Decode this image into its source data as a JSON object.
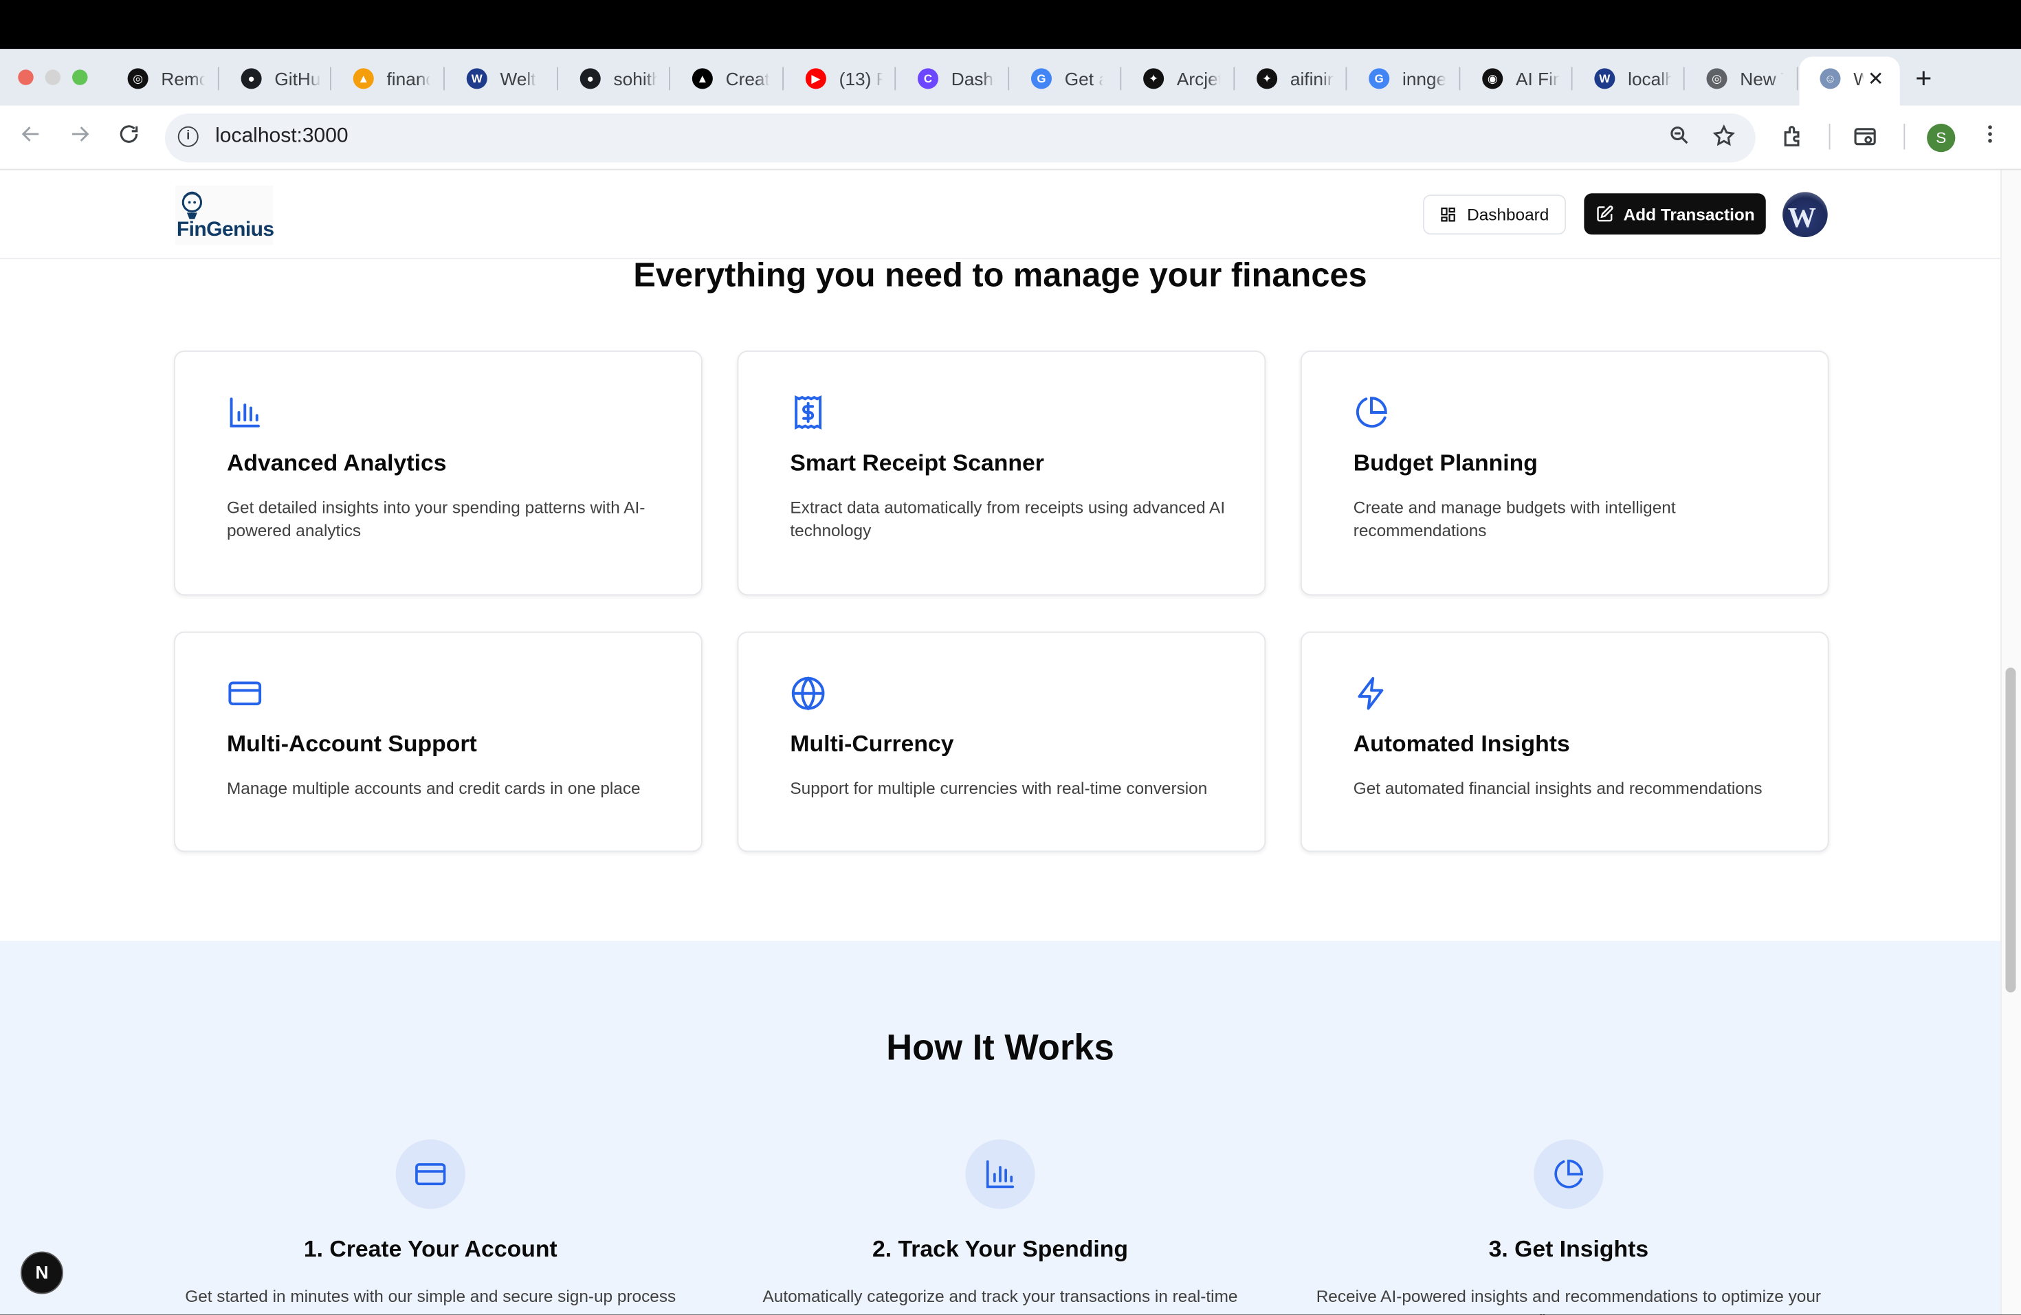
{
  "browser": {
    "tabs": [
      {
        "title": "Remo",
        "icon": "openai-icon"
      },
      {
        "title": "GitHu",
        "icon": "github-icon"
      },
      {
        "title": "financ",
        "icon": "finance-app-icon"
      },
      {
        "title": "Welth",
        "icon": "welth-icon"
      },
      {
        "title": "sohith",
        "icon": "github-icon"
      },
      {
        "title": "Create",
        "icon": "vercel-icon"
      },
      {
        "title": "(13) F",
        "icon": "youtube-icon"
      },
      {
        "title": "Dashb",
        "icon": "clerk-icon"
      },
      {
        "title": "Get a",
        "icon": "google-icon"
      },
      {
        "title": "Arcjet",
        "icon": "arcjet-icon"
      },
      {
        "title": "aifinin",
        "icon": "gemini-icon"
      },
      {
        "title": "innge",
        "icon": "google-icon"
      },
      {
        "title": "AI Fina",
        "icon": "ai-finance-icon"
      },
      {
        "title": "localh",
        "icon": "welth-icon"
      },
      {
        "title": "New T",
        "icon": "chrome-icon"
      },
      {
        "title": "W",
        "icon": "fingenius-icon"
      }
    ],
    "url": "localhost:3000",
    "profile_initial": "S"
  },
  "header": {
    "logo_text": "FinGenius",
    "dashboard_label": "Dashboard",
    "add_transaction_label": "Add Transaction",
    "avatar_letter": "W"
  },
  "features": {
    "title": "Everything you need to manage your finances",
    "cards": [
      {
        "icon": "bar-chart-icon",
        "title": "Advanced Analytics",
        "description": "Get detailed insights into your spending patterns with AI-powered analytics"
      },
      {
        "icon": "receipt-icon",
        "title": "Smart Receipt Scanner",
        "description": "Extract data automatically from receipts using advanced AI technology"
      },
      {
        "icon": "pie-chart-icon",
        "title": "Budget Planning",
        "description": "Create and manage budgets with intelligent recommendations"
      },
      {
        "icon": "credit-card-icon",
        "title": "Multi-Account Support",
        "description": "Manage multiple accounts and credit cards in one place"
      },
      {
        "icon": "globe-icon",
        "title": "Multi-Currency",
        "description": "Support for multiple currencies with real-time conversion"
      },
      {
        "icon": "zap-icon",
        "title": "Automated Insights",
        "description": "Get automated financial insights and recommendations"
      }
    ]
  },
  "how_it_works": {
    "title": "How It Works",
    "steps": [
      {
        "icon": "credit-card-icon",
        "title": "1. Create Your Account",
        "description": "Get started in minutes with our simple and secure sign-up process"
      },
      {
        "icon": "bar-chart-icon",
        "title": "2. Track Your Spending",
        "description": "Automatically categorize and track your transactions in real-time"
      },
      {
        "icon": "pie-chart-icon",
        "title": "3. Get Insights",
        "description": "Receive AI-powered insights and recommendations to optimize your finances"
      }
    ]
  },
  "dev_badge": "N",
  "colors": {
    "accent": "#2563eb",
    "how_bg": "#eef4fd",
    "button_dark": "#0f0f10"
  }
}
